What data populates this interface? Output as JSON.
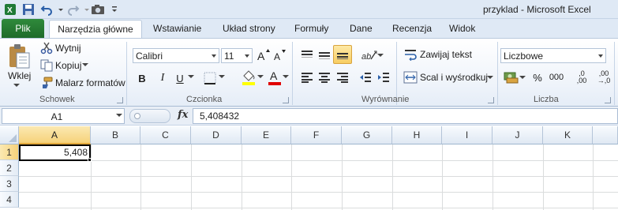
{
  "window": {
    "title": "przyklad  -  Microsoft Excel"
  },
  "qat": {
    "icons": [
      "excel-logo",
      "save-icon",
      "undo-icon",
      "redo-icon",
      "camera-icon",
      "customize-icon"
    ]
  },
  "tabs": {
    "file": "Plik",
    "active": "Narzędzia główne",
    "items": [
      "Wstawianie",
      "Układ strony",
      "Formuły",
      "Dane",
      "Recenzja",
      "Widok"
    ]
  },
  "ribbon": {
    "clipboard": {
      "label": "Schowek",
      "paste": "Wklej",
      "cut": "Wytnij",
      "copy": "Kopiuj",
      "format_painter": "Malarz formatów"
    },
    "font": {
      "label": "Czcionka",
      "font_name": "Calibri",
      "font_size": "11",
      "bold": "B",
      "italic": "I",
      "underline": "U",
      "fill_color": "#ffff00",
      "font_color": "#e00000"
    },
    "alignment": {
      "label": "Wyrównanie",
      "wrap_text": "Zawijaj tekst",
      "merge_center": "Scal i wyśrodkuj"
    },
    "number": {
      "label": "Liczba",
      "format": "Liczbowe",
      "percent": "%",
      "thousands": "000",
      "inc_decimal_top": ",0",
      "inc_decimal_bottom": ",00",
      "dec_decimal_top": ",00",
      "dec_decimal_bottom": "→,0"
    }
  },
  "formula_bar": {
    "name_box": "A1",
    "fx": "fx",
    "value": "5,408432"
  },
  "sheet": {
    "columns": [
      "A",
      "B",
      "C",
      "D",
      "E",
      "F",
      "G",
      "H",
      "I",
      "J",
      "K"
    ],
    "rows": [
      "1",
      "2",
      "3",
      "4"
    ],
    "selected_cell": "A1",
    "a1_display": "5,408"
  },
  "colors": {
    "file_tab": "#1e6b2a",
    "selection_header": "#f6d27a",
    "ribbon_bg": "#eef3fa"
  }
}
